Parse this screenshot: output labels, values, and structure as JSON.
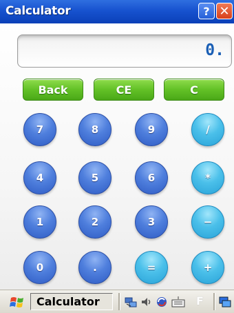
{
  "window": {
    "title": "Calculator",
    "help_label": "?",
    "close_label": "✕"
  },
  "display": {
    "value": "0."
  },
  "function_buttons": {
    "back": "Back",
    "ce": "CE",
    "c": "C"
  },
  "keypad": {
    "k7": "7",
    "k8": "8",
    "k9": "9",
    "div": "/",
    "k4": "4",
    "k5": "5",
    "k6": "6",
    "mul": "*",
    "k1": "1",
    "k2": "2",
    "k3": "3",
    "sub": "−",
    "k0": "0",
    "dot": ".",
    "eq": "=",
    "add": "+"
  },
  "taskbar": {
    "active_window": "Calculator",
    "tray_letter": "F"
  },
  "colors": {
    "title_bar": "#1752cf",
    "display_text": "#1b5fb5",
    "function_button": "#63c127",
    "digit_button": "#4f7fdd",
    "operator_button": "#4bc0ea"
  },
  "icons": [
    "start-flag-icon",
    "network-icon",
    "volume-icon",
    "sync-icon",
    "keyboard-icon",
    "windows-icon"
  ]
}
